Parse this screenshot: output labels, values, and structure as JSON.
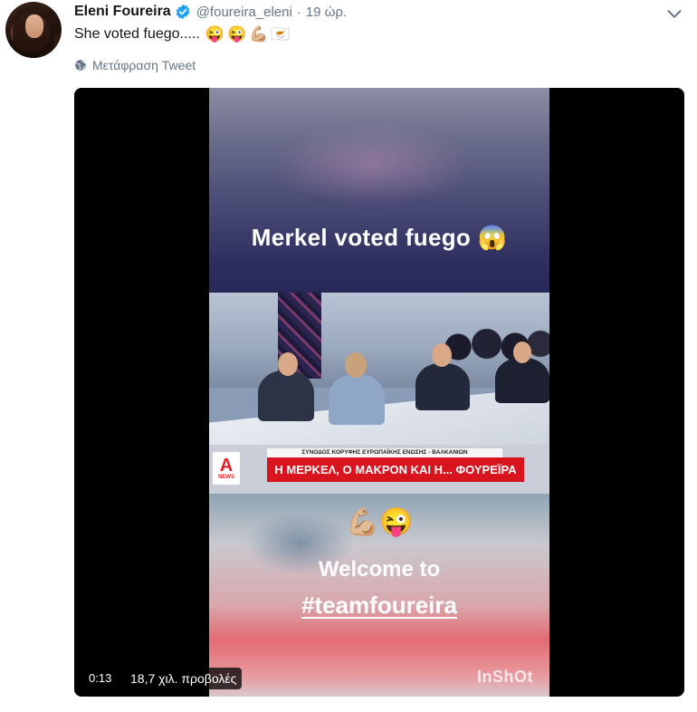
{
  "tweet": {
    "author_name": "Eleni Foureira",
    "handle": "@foureira_eleni",
    "separator": "·",
    "time": "19 ώρ.",
    "text": "She voted fuego.....",
    "emojis": [
      "😜",
      "😜",
      "💪🏼",
      "🇨🇾"
    ],
    "translate_label": "Μετάφραση Tweet",
    "icons": [
      "verified-icon",
      "chevron-down-icon",
      "globe-icon"
    ]
  },
  "video": {
    "caption_top": "Merkel voted fuego 😱",
    "news_logo_letter": "A",
    "news_logo_text": "NEWS",
    "banner_small": "ΣΥΝΟΔΟΣ ΚΟΡΥΦΗΣ ΕΥΡΩΠΑΪΚΗΣ ΕΝΩΣΗΣ - ΒΑΛΚΑΝΙΩΝ",
    "banner_main": "Η ΜΕΡΚΕΛ, Ο ΜΑΚΡΟΝ ΚΑΙ Η... ΦΟΥΡΕΪΡΑ",
    "emoji_row": "💪🏼😜",
    "caption_welcome": "Welcome to",
    "caption_hashtag": "#teamfoureira",
    "watermark": "InShOt",
    "duration": "0:13",
    "views": "18,7 χιλ. προβολές"
  },
  "colors": {
    "verified": "#1da1f2",
    "secondary_text": "#657786",
    "banner_red": "#d8151f"
  }
}
